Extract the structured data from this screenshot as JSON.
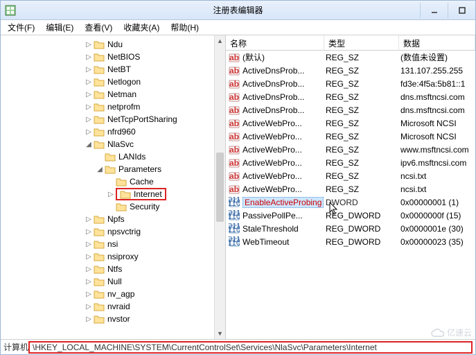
{
  "window": {
    "title": "注册表编辑器"
  },
  "menu": {
    "file": "文件(F)",
    "edit": "编辑(E)",
    "view": "查看(V)",
    "fav": "收藏夹(A)",
    "help": "帮助(H)"
  },
  "tree": [
    {
      "d": 5,
      "e": "▷",
      "l": "Ndu"
    },
    {
      "d": 5,
      "e": "▷",
      "l": "NetBIOS"
    },
    {
      "d": 5,
      "e": "▷",
      "l": "NetBT"
    },
    {
      "d": 5,
      "e": "▷",
      "l": "Netlogon"
    },
    {
      "d": 5,
      "e": "▷",
      "l": "Netman"
    },
    {
      "d": 5,
      "e": "▷",
      "l": "netprofm"
    },
    {
      "d": 5,
      "e": "▷",
      "l": "NetTcpPortSharing"
    },
    {
      "d": 5,
      "e": "▷",
      "l": "nfrd960"
    },
    {
      "d": 5,
      "e": "◢",
      "l": "NlaSvc"
    },
    {
      "d": 6,
      "e": " ",
      "l": "LANIds"
    },
    {
      "d": 6,
      "e": "◢",
      "l": "Parameters"
    },
    {
      "d": 7,
      "e": " ",
      "l": "Cache"
    },
    {
      "d": 7,
      "e": "▷",
      "l": "Internet",
      "hl": true
    },
    {
      "d": 7,
      "e": " ",
      "l": "Security"
    },
    {
      "d": 5,
      "e": "▷",
      "l": "Npfs"
    },
    {
      "d": 5,
      "e": "▷",
      "l": "npsvctrig"
    },
    {
      "d": 5,
      "e": "▷",
      "l": "nsi"
    },
    {
      "d": 5,
      "e": "▷",
      "l": "nsiproxy"
    },
    {
      "d": 5,
      "e": "▷",
      "l": "Ntfs"
    },
    {
      "d": 5,
      "e": "▷",
      "l": "Null"
    },
    {
      "d": 5,
      "e": "▷",
      "l": "nv_agp"
    },
    {
      "d": 5,
      "e": "▷",
      "l": "nvraid"
    },
    {
      "d": 5,
      "e": "▷",
      "l": "nvstor"
    }
  ],
  "columns": {
    "name": "名称",
    "type": "类型",
    "data": "数据"
  },
  "values": [
    {
      "i": "sz",
      "n": "(默认)",
      "t": "REG_SZ",
      "d": "(数值未设置)"
    },
    {
      "i": "sz",
      "n": "ActiveDnsProb...",
      "t": "REG_SZ",
      "d": "131.107.255.255"
    },
    {
      "i": "sz",
      "n": "ActiveDnsProb...",
      "t": "REG_SZ",
      "d": "fd3e:4f5a:5b81::1"
    },
    {
      "i": "sz",
      "n": "ActiveDnsProb...",
      "t": "REG_SZ",
      "d": "dns.msftncsi.com"
    },
    {
      "i": "sz",
      "n": "ActiveDnsProb...",
      "t": "REG_SZ",
      "d": "dns.msftncsi.com"
    },
    {
      "i": "sz",
      "n": "ActiveWebPro...",
      "t": "REG_SZ",
      "d": "Microsoft NCSI"
    },
    {
      "i": "sz",
      "n": "ActiveWebPro...",
      "t": "REG_SZ",
      "d": "Microsoft NCSI"
    },
    {
      "i": "sz",
      "n": "ActiveWebPro...",
      "t": "REG_SZ",
      "d": "www.msftncsi.com"
    },
    {
      "i": "sz",
      "n": "ActiveWebPro...",
      "t": "REG_SZ",
      "d": "ipv6.msftncsi.com"
    },
    {
      "i": "sz",
      "n": "ActiveWebPro...",
      "t": "REG_SZ",
      "d": "ncsi.txt"
    },
    {
      "i": "sz",
      "n": "ActiveWebPro...",
      "t": "REG_SZ",
      "d": "ncsi.txt"
    },
    {
      "i": "dw",
      "n": "EnableActiveProbing",
      "t": "  DWORD",
      "d": "0x00000001 (1)",
      "sel": true
    },
    {
      "i": "dw",
      "n": "PassivePollPe...",
      "t": "REG_DWORD",
      "d": "0x0000000f (15)"
    },
    {
      "i": "dw",
      "n": "StaleThreshold",
      "t": "REG_DWORD",
      "d": "0x0000001e (30)"
    },
    {
      "i": "dw",
      "n": "WebTimeout",
      "t": "REG_DWORD",
      "d": "0x00000023 (35)"
    }
  ],
  "status": {
    "prefix": "计算机",
    "path": "\\HKEY_LOCAL_MACHINE\\SYSTEM\\CurrentControlSet\\Services\\NlaSvc\\Parameters\\Internet"
  },
  "watermark": "亿速云"
}
